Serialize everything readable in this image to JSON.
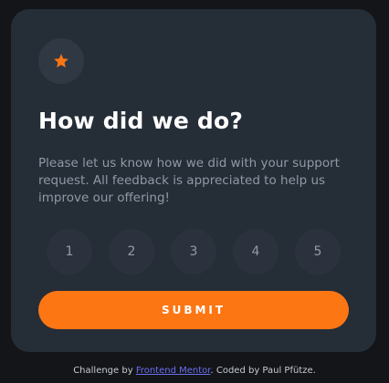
{
  "card": {
    "icon": "star-icon",
    "title": "How did we do?",
    "description": "Please let us know how we did with your support request. All feedback is appreciated to help us improve our offering!",
    "ratings": [
      "1",
      "2",
      "3",
      "4",
      "5"
    ],
    "submit_label": "SUBMIT"
  },
  "attribution": {
    "prefix": "Challenge by ",
    "link_text": "Frontend Mentor",
    "suffix": ". Coded by Paul Pfütze."
  },
  "colors": {
    "page_background": "#131518",
    "card_background": "#252d37",
    "accent_orange": "#fc7614",
    "text_white": "#ffffff",
    "text_gray": "#9199a6",
    "link_blue": "#6b6ff0"
  }
}
